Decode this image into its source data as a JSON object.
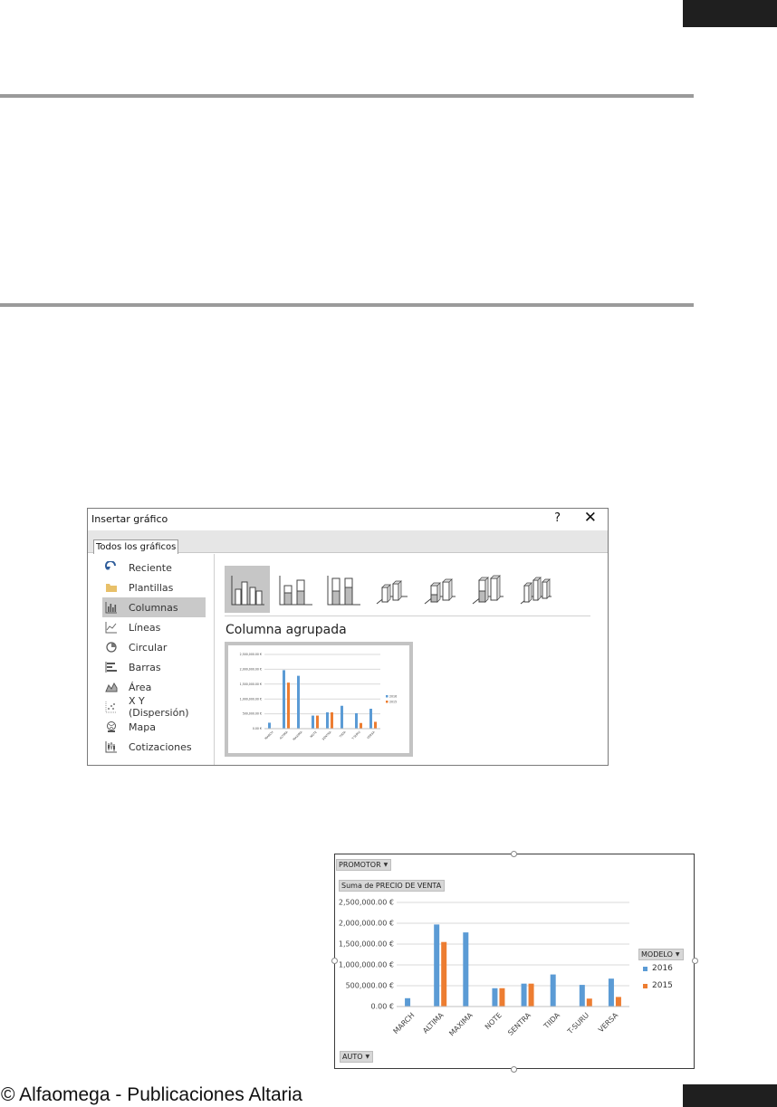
{
  "dialog": {
    "title": "Insertar gráfico",
    "help": "?",
    "close": "✕",
    "tab": "Todos los gráficos",
    "categories": [
      {
        "label": "Reciente",
        "icon": "recent-icon"
      },
      {
        "label": "Plantillas",
        "icon": "folder-icon"
      },
      {
        "label": "Columnas",
        "icon": "column-chart-icon",
        "selected": true
      },
      {
        "label": "Líneas",
        "icon": "line-chart-icon"
      },
      {
        "label": "Circular",
        "icon": "pie-chart-icon"
      },
      {
        "label": "Barras",
        "icon": "bar-chart-icon"
      },
      {
        "label": "Área",
        "icon": "area-chart-icon"
      },
      {
        "label": "X Y (Dispersión)",
        "icon": "scatter-chart-icon"
      },
      {
        "label": "Mapa",
        "icon": "map-icon"
      },
      {
        "label": "Cotizaciones",
        "icon": "stock-chart-icon"
      }
    ],
    "subtype_title": "Columna agrupada"
  },
  "pivot": {
    "filter_button": "PROMOTOR",
    "value_button": "Suma de PRECIO DE VENTA",
    "legend_button": "MODELO",
    "axis_button": "AUTO"
  },
  "chart_data": [
    {
      "type": "bar",
      "categories": [
        "MARCH",
        "ALTIMA",
        "MAXIMA",
        "NOTE",
        "SENTRA",
        "TIIDA",
        "T-SURU",
        "VERSA"
      ],
      "series": [
        {
          "name": "2016",
          "values": [
            200000,
            1970000,
            1780000,
            440000,
            550000,
            770000,
            520000,
            670000
          ]
        },
        {
          "name": "2015",
          "values": [
            0,
            1550000,
            0,
            440000,
            550000,
            0,
            190000,
            230000
          ]
        }
      ],
      "yticks": [
        "0.00 €",
        "500,000.00 €",
        "1,000,000.00 €",
        "1,500,000.00 €",
        "2,000,000.00 €",
        "2,500,000.00 €"
      ],
      "ylim": [
        0,
        2500000
      ],
      "grid": true,
      "legend": "right",
      "colors": {
        "2016": "#5b9bd5",
        "2015": "#ed7d31"
      }
    },
    {
      "type": "bar",
      "categories": [
        "MARCH",
        "ALTIMA",
        "MAXIMA",
        "NOTE",
        "SENTRA",
        "TIIDA",
        "T-SURU",
        "VERSA"
      ],
      "series": [
        {
          "name": "2016",
          "values": [
            200000,
            1970000,
            1780000,
            440000,
            550000,
            770000,
            520000,
            670000
          ]
        },
        {
          "name": "2015",
          "values": [
            0,
            1550000,
            0,
            440000,
            550000,
            0,
            190000,
            230000
          ]
        }
      ],
      "yticks": [
        "0.00 €",
        "500,000.00 €",
        "1,000,000.00 €",
        "1,500,000.00 €",
        "2,000,000.00 €",
        "2,500,000.00 €"
      ],
      "ylim": [
        0,
        2500000
      ],
      "grid": true,
      "legend": "right",
      "colors": {
        "2016": "#5b9bd5",
        "2015": "#ed7d31"
      }
    }
  ],
  "footer": "© Alfaomega - Publicaciones Altaria"
}
